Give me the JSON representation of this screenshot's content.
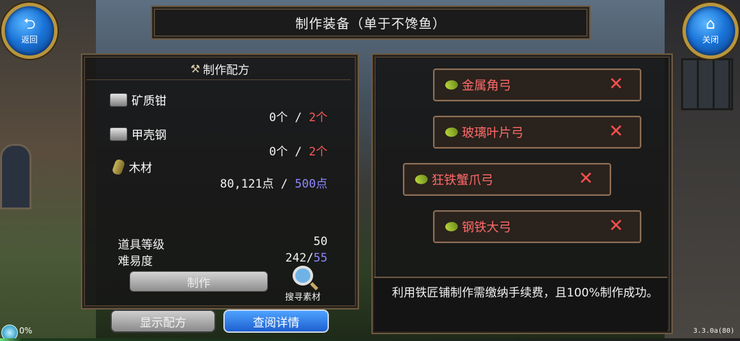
{
  "nav": {
    "back_label": "返回",
    "close_label": "关闭"
  },
  "title": "制作装备（单于不馋鱼）",
  "recipe": {
    "header": "制作配方",
    "materials": [
      {
        "name": "矿质钳",
        "have": "0个",
        "need": "2个",
        "need_color": "#ff5a5a"
      },
      {
        "name": "甲壳钢",
        "have": "0个",
        "need": "2个",
        "need_color": "#ff5a5a"
      },
      {
        "name": "木材",
        "have": "80,121点",
        "need": "500点",
        "need_color": "#8e88ff"
      }
    ],
    "item_level_label": "道具等级",
    "item_level_value": "50",
    "difficulty_label": "难易度",
    "difficulty_current": "242",
    "difficulty_max": "55",
    "craft_button": "制作",
    "search_label": "搜寻素材"
  },
  "buttons": {
    "show_recipe": "显示配方",
    "view_detail": "查阅详情"
  },
  "items": [
    {
      "name": "金属角弓"
    },
    {
      "name": "玻璃叶片弓"
    },
    {
      "name": "狂铁蟹爪弓"
    },
    {
      "name": "钢铁大弓"
    }
  ],
  "description": "利用铁匠铺制作需缴纳手续费，且100%制作成功。",
  "status": {
    "progress": "0%",
    "version": "3.3.0a(80)"
  },
  "colors": {
    "panel_border": "#6d5a43",
    "item_name": "#ff6a6a",
    "accent_blue": "#1d5fd0"
  }
}
